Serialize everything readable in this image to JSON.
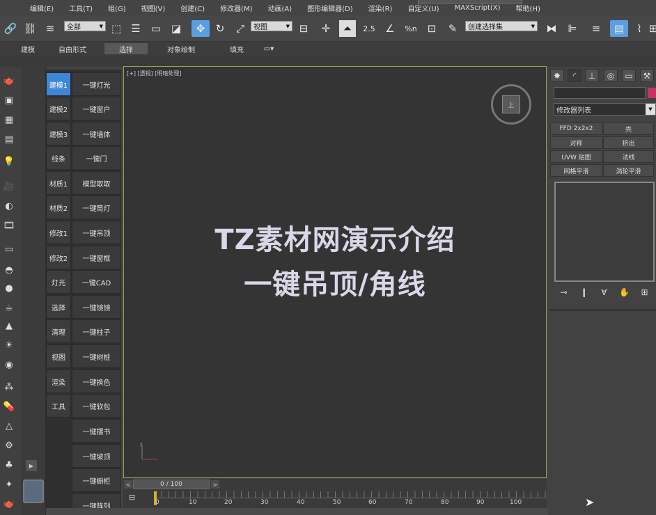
{
  "menu": {
    "items": [
      "编辑(E)",
      "工具(T)",
      "组(G)",
      "视图(V)",
      "创建(C)",
      "修改器(M)",
      "动画(A)",
      "图形编辑器(D)",
      "渲染(R)",
      "自定义(U)",
      "MAXScript(X)",
      "帮助(H)"
    ]
  },
  "toolbar": {
    "selection_filter": "全部",
    "reference_coord": "视图",
    "named_selection": "创建选择集",
    "snap_label": "2.5",
    "percent_snap": "%n",
    "spinner_snap": "ⁿ"
  },
  "ribbon": {
    "tabs": [
      "建模",
      "自由形式",
      "选择",
      "对象绘制",
      "填充"
    ],
    "active_tab": "选择"
  },
  "plugin": {
    "left_buttons": [
      "建模1",
      "建模2",
      "建模3",
      "线条",
      "材质1",
      "材质2",
      "修改1",
      "修改2",
      "灯光",
      "选择",
      "清理",
      "视图",
      "渲染",
      "工具"
    ],
    "right_buttons": [
      "一键灯光",
      "一键窗户",
      "一键墙体",
      "一键门",
      "模型取取",
      "一键筒灯",
      "一键吊顶",
      "一键窗框",
      "一键CAD",
      "一键镜镜",
      "一键柱子",
      "一键树桩",
      "一键换色",
      "一键软包",
      "一键摆书",
      "一键坡顶",
      "一键橱柜",
      "一键阵列"
    ],
    "active_left": "建模1"
  },
  "viewport": {
    "label": "[+] [透视] [明暗处理]",
    "viewcube_face": "上",
    "title_line1": "TZ素材网演示介绍",
    "title_line2": "一键吊顶/角线",
    "axis_y": "y",
    "colors": {
      "border": "#a0a050",
      "background": "#343434",
      "title": "#d8d8e8"
    }
  },
  "timeline": {
    "slider_label": "0 / 100",
    "current_frame": 0,
    "total_frames": 100,
    "ticks": [
      "0",
      "10",
      "20",
      "30",
      "40",
      "50",
      "60",
      "70",
      "80",
      "90",
      "100"
    ],
    "prev_label": "<",
    "next_label": ">"
  },
  "command_panel": {
    "modifier_list": "修改器列表",
    "modifier_buttons": [
      "FFD 2x2x2",
      "壳",
      "对称",
      "挤出",
      "UVW 贴图",
      "法线",
      "网格平滑",
      "涡轮平滑"
    ],
    "color_swatch": "#c53369"
  },
  "accent_color": "#3e87d8"
}
